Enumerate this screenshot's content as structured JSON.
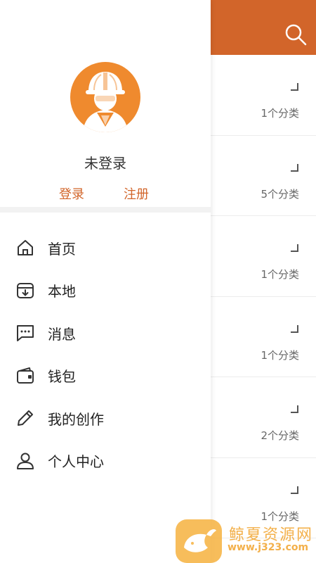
{
  "background_list": {
    "rows": [
      {
        "count": "1个分类"
      },
      {
        "count": "5个分类"
      },
      {
        "count": "1个分类"
      },
      {
        "count": "1个分类"
      },
      {
        "count": "2个分类"
      },
      {
        "count": "1个分类"
      }
    ]
  },
  "drawer": {
    "username": "未登录",
    "login_label": "登录",
    "register_label": "注册",
    "menu": [
      {
        "label": "首页",
        "icon": "home-icon"
      },
      {
        "label": "本地",
        "icon": "local-box-icon"
      },
      {
        "label": "消息",
        "icon": "message-icon"
      },
      {
        "label": "钱包",
        "icon": "wallet-icon"
      },
      {
        "label": "我的创作",
        "icon": "pencil-icon"
      },
      {
        "label": "个人中心",
        "icon": "person-icon"
      }
    ]
  },
  "watermark": {
    "brand": "鲸夏资源网",
    "url": "www.j323.com"
  },
  "colors": {
    "accent": "#d2652a",
    "avatar_bg": "#ef8a2e"
  }
}
